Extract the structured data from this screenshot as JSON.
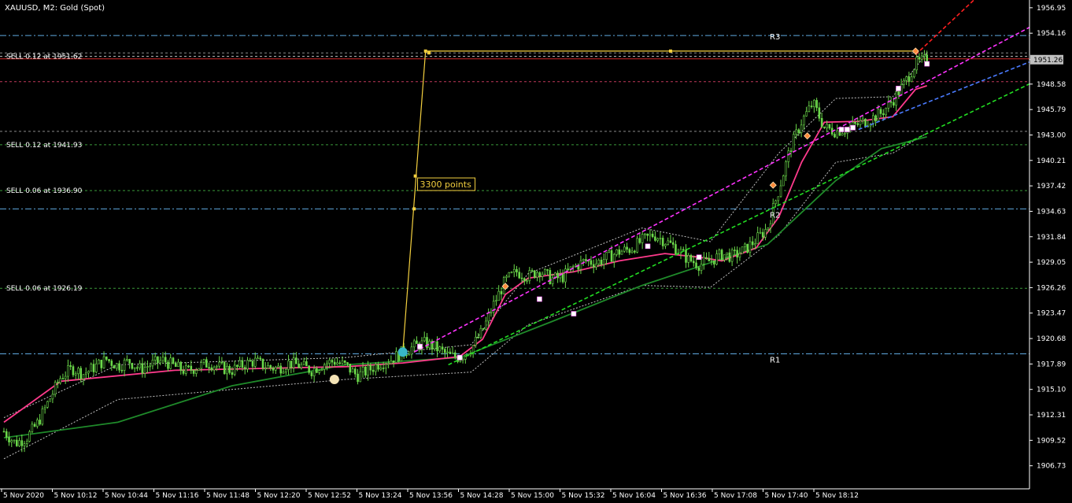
{
  "window_title": "XAUUSD, M2:  Gold (Spot)",
  "chart_data": {
    "type": "candlestick",
    "symbol": "XAUUSD",
    "timeframe": "M2",
    "instrument": "Gold (Spot)",
    "ylim": [
      1904.2,
      1957.8
    ],
    "y_ticks": [
      "1956.95",
      "1954.16",
      "1951.26",
      "1948.58",
      "1945.79",
      "1943.00",
      "1940.21",
      "1937.42",
      "1934.63",
      "1931.84",
      "1929.05",
      "1926.26",
      "1923.47",
      "1920.68",
      "1917.89",
      "1915.10",
      "1912.31",
      "1909.52",
      "1906.73"
    ],
    "x_ticks": [
      "5 Nov 2020",
      "5 Nov 10:12",
      "5 Nov 10:44",
      "5 Nov 11:16",
      "5 Nov 11:48",
      "5 Nov 12:20",
      "5 Nov 12:52",
      "5 Nov 13:24",
      "5 Nov 13:56",
      "5 Nov 14:28",
      "5 Nov 15:00",
      "5 Nov 15:32",
      "5 Nov 16:04",
      "5 Nov 16:36",
      "5 Nov 17:08",
      "5 Nov 17:40",
      "5 Nov 18:12"
    ],
    "current_price": "1951.26",
    "price_path": [
      [
        0,
        1910.5
      ],
      [
        2,
        1909.2
      ],
      [
        4,
        1909.8
      ],
      [
        6,
        1911.5
      ],
      [
        8,
        1914.0
      ],
      [
        10,
        1916.5
      ],
      [
        12,
        1917.4
      ],
      [
        14,
        1916.8
      ],
      [
        16,
        1917.6
      ],
      [
        18,
        1918.4
      ],
      [
        20,
        1917.7
      ],
      [
        22,
        1918.2
      ],
      [
        24,
        1917.3
      ],
      [
        26,
        1917.9
      ],
      [
        28,
        1918.3
      ],
      [
        30,
        1917.6
      ],
      [
        32,
        1917.1
      ],
      [
        34,
        1917.6
      ],
      [
        36,
        1918.0
      ],
      [
        38,
        1917.5
      ],
      [
        40,
        1917.2
      ],
      [
        42,
        1917.8
      ],
      [
        44,
        1918.2
      ],
      [
        46,
        1917.6
      ],
      [
        48,
        1917.4
      ],
      [
        50,
        1918.0
      ],
      [
        52,
        1917.7
      ],
      [
        54,
        1917.2
      ],
      [
        56,
        1917.9
      ],
      [
        58,
        1918.2
      ],
      [
        60,
        1917.7
      ],
      [
        62,
        1916.6
      ],
      [
        64,
        1917.2
      ],
      [
        66,
        1918.0
      ],
      [
        68,
        1918.4
      ],
      [
        70,
        1919.2
      ],
      [
        72,
        1919.8
      ],
      [
        74,
        1920.2
      ],
      [
        76,
        1919.6
      ],
      [
        78,
        1918.8
      ],
      [
        80,
        1918.6
      ],
      [
        82,
        1919.6
      ],
      [
        84,
        1921.5
      ],
      [
        86,
        1924.5
      ],
      [
        88,
        1927.0
      ],
      [
        90,
        1928.0
      ],
      [
        92,
        1927.5
      ],
      [
        94,
        1928.2
      ],
      [
        96,
        1927.2
      ],
      [
        98,
        1927.4
      ],
      [
        100,
        1928.5
      ],
      [
        102,
        1929.2
      ],
      [
        104,
        1929.0
      ],
      [
        106,
        1929.6
      ],
      [
        108,
        1930.2
      ],
      [
        110,
        1930.5
      ],
      [
        112,
        1931.4
      ],
      [
        114,
        1932.1
      ],
      [
        116,
        1931.4
      ],
      [
        118,
        1930.6
      ],
      [
        120,
        1929.4
      ],
      [
        122,
        1928.8
      ],
      [
        124,
        1929.2
      ],
      [
        126,
        1929.9
      ],
      [
        128,
        1929.7
      ],
      [
        130,
        1930.4
      ],
      [
        132,
        1931.5
      ],
      [
        134,
        1932.8
      ],
      [
        136,
        1937.0
      ],
      [
        138,
        1941.5
      ],
      [
        140,
        1944.5
      ],
      [
        142,
        1946.5
      ],
      [
        144,
        1943.8
      ],
      [
        146,
        1943.4
      ],
      [
        148,
        1943.7
      ],
      [
        150,
        1944.2
      ],
      [
        152,
        1944.7
      ],
      [
        154,
        1945.4
      ],
      [
        156,
        1946.8
      ],
      [
        158,
        1948.6
      ],
      [
        160,
        1950.8
      ],
      [
        162,
        1951.3
      ]
    ],
    "fast_ma": [
      [
        0,
        1911.5
      ],
      [
        10,
        1916.0
      ],
      [
        30,
        1917.2
      ],
      [
        60,
        1917.6
      ],
      [
        70,
        1918.0
      ],
      [
        80,
        1918.7
      ],
      [
        84,
        1920.6
      ],
      [
        88,
        1925.5
      ],
      [
        92,
        1927.3
      ],
      [
        100,
        1928.0
      ],
      [
        108,
        1929.2
      ],
      [
        116,
        1930.0
      ],
      [
        122,
        1929.6
      ],
      [
        126,
        1929.2
      ],
      [
        132,
        1930.6
      ],
      [
        136,
        1934.0
      ],
      [
        140,
        1940.0
      ],
      [
        144,
        1944.4
      ],
      [
        150,
        1944.5
      ],
      [
        156,
        1945.0
      ],
      [
        160,
        1948.0
      ],
      [
        162,
        1948.4
      ]
    ],
    "slow_ma": [
      [
        0,
        1909.8
      ],
      [
        20,
        1911.5
      ],
      [
        40,
        1915.5
      ],
      [
        60,
        1917.8
      ],
      [
        80,
        1918.6
      ],
      [
        96,
        1922.5
      ],
      [
        112,
        1926.5
      ],
      [
        124,
        1929.0
      ],
      [
        134,
        1931.0
      ],
      [
        146,
        1938.0
      ],
      [
        154,
        1941.5
      ],
      [
        162,
        1942.8
      ]
    ],
    "envelope_upper": [
      [
        0,
        1912.0
      ],
      [
        20,
        1917.8
      ],
      [
        60,
        1918.6
      ],
      [
        82,
        1920.0
      ],
      [
        92,
        1927.8
      ],
      [
        112,
        1932.8
      ],
      [
        124,
        1931.3
      ],
      [
        136,
        1941.0
      ],
      [
        146,
        1947.0
      ],
      [
        156,
        1947.2
      ],
      [
        162,
        1952.0
      ]
    ],
    "envelope_lower": [
      [
        0,
        1907.5
      ],
      [
        20,
        1914.0
      ],
      [
        60,
        1916.2
      ],
      [
        82,
        1917.0
      ],
      [
        92,
        1922.2
      ],
      [
        112,
        1926.5
      ],
      [
        124,
        1926.3
      ],
      [
        136,
        1932.0
      ],
      [
        146,
        1940.0
      ],
      [
        156,
        1941.0
      ],
      [
        162,
        1943.2
      ]
    ],
    "levels": [
      {
        "label": "R3",
        "price": 1953.9,
        "color": "#5fa9e0"
      },
      {
        "label": "R2",
        "price": 1934.9,
        "color": "#5fa9e0"
      },
      {
        "label": "R1",
        "price": 1919.0,
        "color": "#5fa9e0"
      }
    ],
    "orders": [
      {
        "label": "SELL 0.12 at 1951.62",
        "price": 1951.62
      },
      {
        "label": "SELL 0.12 at 1941.93",
        "price": 1941.93
      },
      {
        "label": "SELL 0.06 at 1936.90",
        "price": 1936.9
      },
      {
        "label": "SELL 0.06 at 1926.19",
        "price": 1926.19
      }
    ],
    "extra_levels": [
      {
        "price": 1952.0
      },
      {
        "price": 1948.85
      },
      {
        "price": 1943.4
      }
    ],
    "trendlines": [
      {
        "color": "#ff33ff",
        "p1": [
          72,
          1919.2
        ],
        "p2": [
          180,
          1954.8
        ]
      },
      {
        "color": "#4a7bff",
        "p1": [
          150,
          1943.6
        ],
        "p2": [
          180,
          1951.0
        ]
      },
      {
        "color": "#22dd22",
        "p1": [
          78,
          1917.8
        ],
        "p2": [
          180,
          1948.6
        ]
      },
      {
        "color": "#ff2020",
        "p1": [
          160,
          1951.8
        ],
        "p2": [
          174,
          1960
        ]
      }
    ],
    "measure": {
      "label": "3300 points",
      "p_start": [
        70,
        1919.2
      ],
      "p_end": [
        74,
        1952.2
      ],
      "p_right": [
        160,
        1952.2
      ]
    },
    "markers": [
      {
        "t": 73,
        "p": 1919.8,
        "color": "#ffffff"
      },
      {
        "t": 80,
        "p": 1918.6,
        "color": "#ffffff"
      },
      {
        "t": 94,
        "p": 1925.0,
        "color": "#ffffff"
      },
      {
        "t": 100,
        "p": 1923.4,
        "color": "#ffffff"
      },
      {
        "t": 113,
        "p": 1930.8,
        "color": "#ffffff"
      },
      {
        "t": 122,
        "p": 1929.6,
        "color": "#ffffff"
      },
      {
        "t": 147,
        "p": 1943.6,
        "color": "#ffffff"
      },
      {
        "t": 148,
        "p": 1943.6,
        "color": "#ffffff"
      },
      {
        "t": 149,
        "p": 1943.8,
        "color": "#ffffff"
      },
      {
        "t": 157,
        "p": 1948.1,
        "color": "#ffffff"
      },
      {
        "t": 162,
        "p": 1950.8,
        "color": "#ffffff"
      },
      {
        "t": 88,
        "p": 1926.4,
        "color": "#ff8a3a"
      },
      {
        "t": 135,
        "p": 1937.5,
        "color": "#ff8a3a"
      },
      {
        "t": 141,
        "p": 1942.9,
        "color": "#ff8a3a"
      },
      {
        "t": 160,
        "p": 1952.2,
        "color": "#ff8a3a"
      }
    ],
    "circles": [
      {
        "t": 58,
        "p": 1916.2,
        "color": "#f4e3b5"
      },
      {
        "t": 70,
        "p": 1919.2,
        "color": "#38b8c8"
      }
    ]
  }
}
